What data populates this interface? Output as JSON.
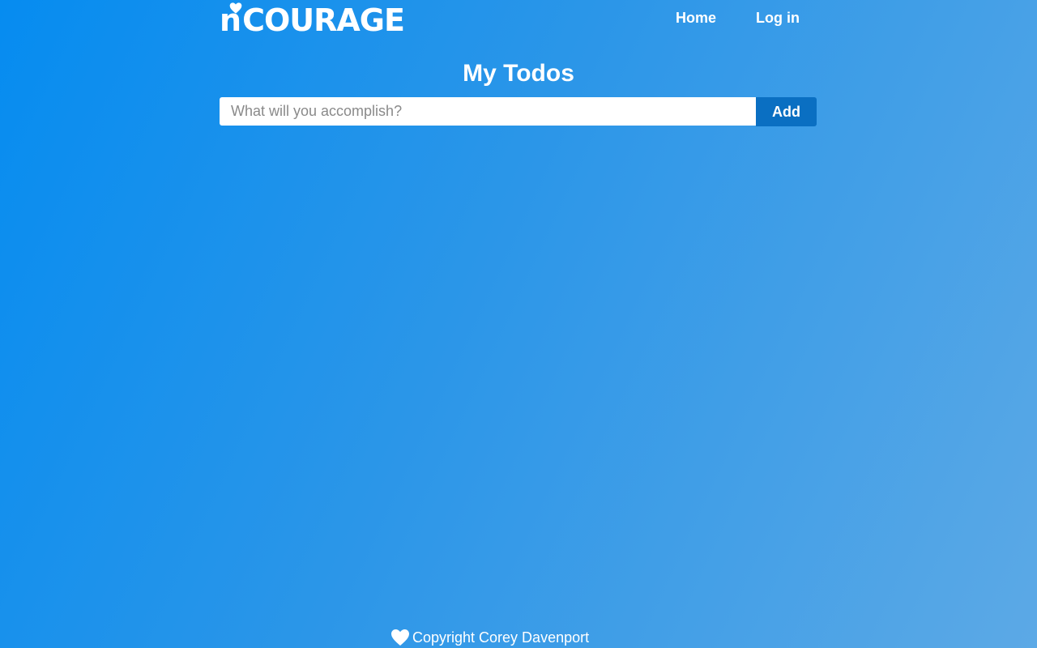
{
  "brand": {
    "logo_n": "n",
    "logo_word": "COURAGE",
    "logo_icon": "heart-icon"
  },
  "nav": {
    "home_label": "Home",
    "login_label": "Log in"
  },
  "main": {
    "title": "My Todos",
    "input_placeholder": "What will you accomplish?",
    "input_value": "",
    "add_label": "Add"
  },
  "footer": {
    "icon": "heart-icon",
    "copyright": "Copyright Corey Davenport"
  },
  "colors": {
    "background_start": "#068cf0",
    "background_end": "#5ca9e6",
    "add_button": "#0a6fc2",
    "text": "#ffffff"
  }
}
